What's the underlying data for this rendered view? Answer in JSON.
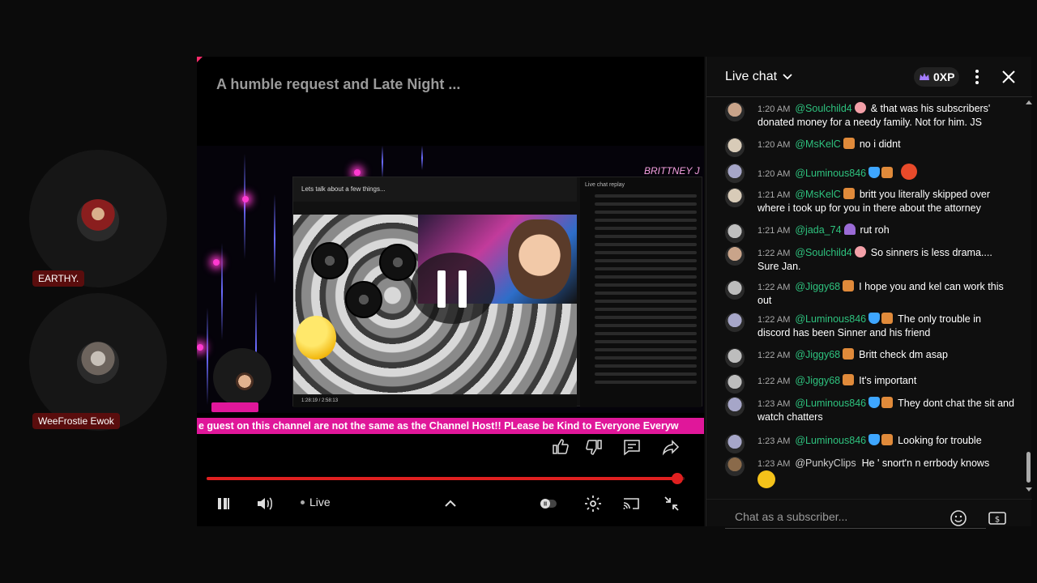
{
  "participants": [
    {
      "name": "EARTHY."
    },
    {
      "name": "WeeFrostie Ewok"
    }
  ],
  "player": {
    "title": "A humble request and Late Night ...",
    "inner_header": "Lets talk about a few things...",
    "inner_chat_title": "Live chat replay",
    "inner_overlay_name": "BRITTNEY J",
    "inner_time": "1:28:19 / 2:58:13",
    "marquee": "e guest on this channel are not the same as the Channel Host!! PLease be Kind to Everyone Everyw",
    "live_label": "Live",
    "progress_fraction": 0.985
  },
  "chat": {
    "title": "Live chat",
    "xp": "0XP",
    "input_placeholder": "Chat as a subscriber...",
    "messages": [
      {
        "time": "1:20 AM",
        "author": "@Soulchild4",
        "badges": [
          "pig"
        ],
        "text": "& that was his subscribers' donated money for a needy family. Not for him. JS",
        "color": "#2ec27e"
      },
      {
        "time": "1:20 AM",
        "author": "@MsKelC",
        "badges": [
          "fist"
        ],
        "text": "no i didnt",
        "color": "#2ec27e"
      },
      {
        "time": "1:20 AM",
        "author": "@Luminous846",
        "badges": [
          "shield",
          "fist"
        ],
        "text": "",
        "emoji": true,
        "color": "#2ec27e"
      },
      {
        "time": "1:21 AM",
        "author": "@MsKelC",
        "badges": [
          "fist"
        ],
        "text": "britt you literally skipped over where i took up for you in there about the attorney",
        "color": "#2ec27e"
      },
      {
        "time": "1:21 AM",
        "author": "@jada_74",
        "badges": [
          "umbrella"
        ],
        "text": "rut roh",
        "color": "#2ec27e"
      },
      {
        "time": "1:22 AM",
        "author": "@Soulchild4",
        "badges": [
          "pig"
        ],
        "text": "So sinners is less drama.... Sure Jan.",
        "color": "#2ec27e"
      },
      {
        "time": "1:22 AM",
        "author": "@Jiggy68",
        "badges": [
          "fist"
        ],
        "text": "I hope you and kel can work this out",
        "color": "#2ec27e"
      },
      {
        "time": "1:22 AM",
        "author": "@Luminous846",
        "badges": [
          "shield",
          "fist"
        ],
        "text": "The only trouble in discord has been Sinner and his friend",
        "color": "#2ec27e"
      },
      {
        "time": "1:22 AM",
        "author": "@Jiggy68",
        "badges": [
          "fist"
        ],
        "text": "Britt check dm asap",
        "color": "#2ec27e"
      },
      {
        "time": "1:22 AM",
        "author": "@Jiggy68",
        "badges": [
          "fist"
        ],
        "text": "It's important",
        "color": "#2ec27e"
      },
      {
        "time": "1:23 AM",
        "author": "@Luminous846",
        "badges": [
          "shield",
          "fist"
        ],
        "text": "They dont chat the sit and watch chatters",
        "color": "#2ec27e"
      },
      {
        "time": "1:23 AM",
        "author": "@Luminous846",
        "badges": [
          "shield",
          "fist"
        ],
        "text": "Looking for trouble",
        "color": "#2ec27e"
      },
      {
        "time": "1:23 AM",
        "author": "@PunkyClips",
        "badges": [],
        "text": "He ' snort'n n errbody knows",
        "laugh": true,
        "color": "#cfcfcf"
      }
    ]
  },
  "colors": {
    "accent": "#e02020",
    "marquee": "#e0179a",
    "author_green": "#2ec27e",
    "name_tag": "#5a0d0d"
  }
}
